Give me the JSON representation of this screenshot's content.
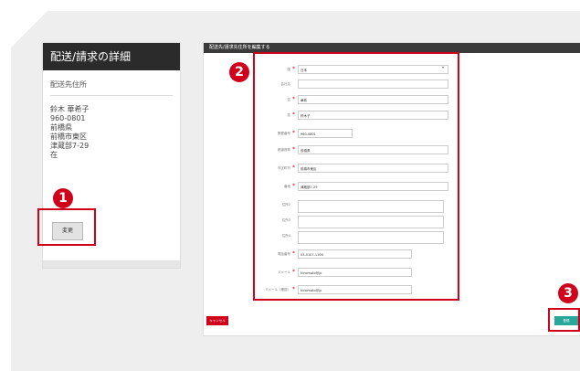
{
  "left": {
    "title": "配送/請求の詳細",
    "subtitle": "配送先住所",
    "address_lines": [
      "鈴木 華希子",
      "960-0801",
      "前橋県",
      "前橋市東区",
      "津蔵部7-29",
      "在"
    ],
    "change_label": "変更"
  },
  "badges": {
    "one": "1",
    "two": "2",
    "three": "3"
  },
  "form": {
    "title": "配送先/請求先住所を編集する",
    "fields": [
      {
        "label": "国",
        "value": "日本",
        "select": true
      },
      {
        "label": "会社名",
        "value": ""
      },
      {
        "label": "名",
        "value": "華希"
      },
      {
        "label": "姓",
        "value": "鈴木子"
      },
      {
        "label": "郵便番号",
        "value": "960-0801"
      },
      {
        "label": "都道府県",
        "value": "前橋県"
      },
      {
        "label": "市区町村",
        "value": "前橋市東区"
      },
      {
        "label": "番地",
        "value": "津蔵部7-29"
      },
      {
        "label": "住所2",
        "value": ""
      },
      {
        "label": "住所3",
        "value": ""
      },
      {
        "label": "住所4",
        "value": ""
      },
      {
        "label": "電話番号",
        "value": "03-0107-1100"
      },
      {
        "label": "Eメール",
        "value": "hinomoto@jp"
      },
      {
        "label": "Eメール（確認）",
        "value": "hinomoto@jp"
      }
    ],
    "back_label": "キャンセル",
    "register_label": "登録"
  },
  "colors": {
    "highlight": "#d0021b",
    "register": "#2aa79b",
    "header": "#2b2b2b"
  }
}
